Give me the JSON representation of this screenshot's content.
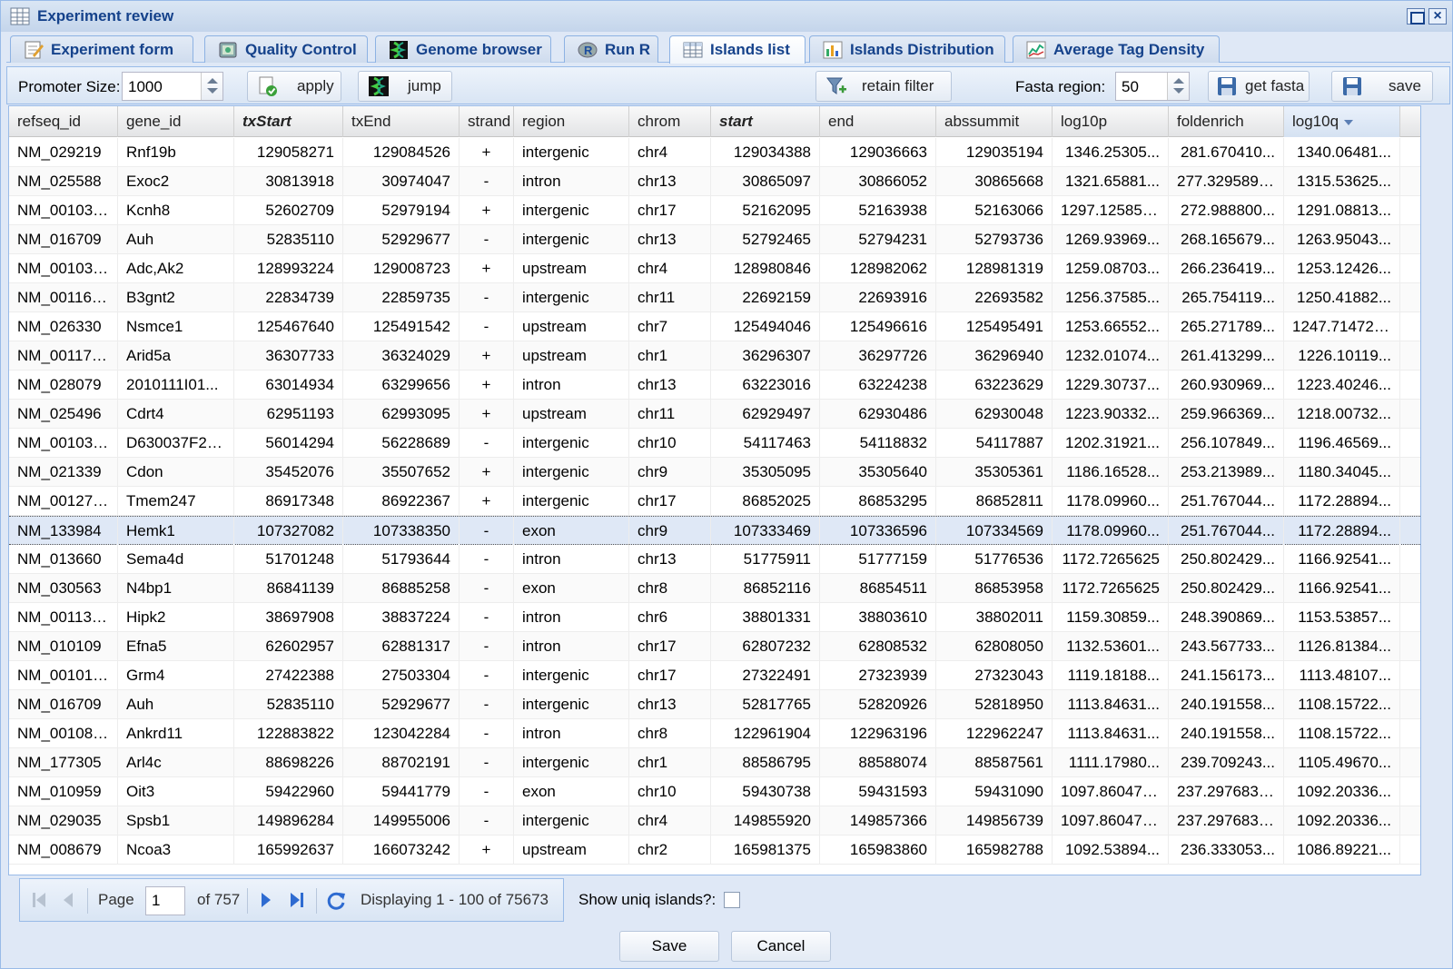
{
  "window": {
    "title": "Experiment review"
  },
  "tabs": [
    {
      "label": "Experiment form",
      "icon": "form-icon"
    },
    {
      "label": "Quality Control",
      "icon": "quality-control-icon"
    },
    {
      "label": "Genome browser",
      "icon": "genome-browser-icon"
    },
    {
      "label": "Run R",
      "icon": "r-logo-icon"
    },
    {
      "label": "Islands list",
      "icon": "table-icon",
      "active": true
    },
    {
      "label": "Islands Distribution",
      "icon": "bar-chart-icon"
    },
    {
      "label": "Average Tag Density",
      "icon": "line-chart-icon"
    }
  ],
  "toolbar": {
    "promoter_label": "Promoter Size:",
    "promoter_value": "1000",
    "apply_label": "apply",
    "jump_label": "jump",
    "retain_filter_label": "retain filter",
    "fasta_label": "Fasta region:",
    "fasta_value": "50",
    "get_fasta_label": "get fasta",
    "save_label": "save"
  },
  "grid": {
    "columns": [
      "refseq_id",
      "gene_id",
      "txStart",
      "txEnd",
      "strand",
      "region",
      "chrom",
      "start",
      "end",
      "abssummit",
      "log10p",
      "foldenrich",
      "log10q"
    ],
    "sorted_column": "log10q",
    "bold_columns": [
      "txStart",
      "start"
    ],
    "selected_row": 13,
    "rows": [
      [
        "NM_029219",
        "Rnf19b",
        "129058271",
        "129084526",
        "+",
        "intergenic",
        "chr4",
        "129034388",
        "129036663",
        "129035194",
        "1346.25305...",
        "281.670410...",
        "1340.06481..."
      ],
      [
        "NM_025588",
        "Exoc2",
        "30813918",
        "30974047",
        "-",
        "intron",
        "chr13",
        "30865097",
        "30866052",
        "30865668",
        "1321.65881...",
        "277.3295898...",
        "1315.53625..."
      ],
      [
        "NM_001031...",
        "Kcnh8",
        "52602709",
        "52979194",
        "+",
        "intergenic",
        "chr17",
        "52162095",
        "52163938",
        "52163066",
        "1297.125854...",
        "272.988800...",
        "1291.08813..."
      ],
      [
        "NM_016709",
        "Auh",
        "52835110",
        "52929677",
        "-",
        "intergenic",
        "chr13",
        "52792465",
        "52794231",
        "52793736",
        "1269.93969...",
        "268.165679...",
        "1263.95043..."
      ],
      [
        "NM_001033...",
        "Adc,Ak2",
        "128993224",
        "129008723",
        "+",
        "upstream",
        "chr4",
        "128980846",
        "128982062",
        "128981319",
        "1259.08703...",
        "266.236419...",
        "1253.12426..."
      ],
      [
        "NM_001169...",
        "B3gnt2",
        "22834739",
        "22859735",
        "-",
        "intergenic",
        "chr11",
        "22692159",
        "22693916",
        "22693582",
        "1256.37585...",
        "265.754119...",
        "1250.41882..."
      ],
      [
        "NM_026330",
        "Nsmce1",
        "125467640",
        "125491542",
        "-",
        "upstream",
        "chr7",
        "125494046",
        "125496616",
        "125495491",
        "1253.66552...",
        "265.271789...",
        "1247.714721..."
      ],
      [
        "NM_001172...",
        "Arid5a",
        "36307733",
        "36324029",
        "+",
        "upstream",
        "chr1",
        "36296307",
        "36297726",
        "36296940",
        "1232.01074...",
        "261.413299...",
        "1226.10119..."
      ],
      [
        "NM_028079",
        "2010111I01...",
        "63014934",
        "63299656",
        "+",
        "intron",
        "chr13",
        "63223016",
        "63224238",
        "63223629",
        "1229.30737...",
        "260.930969...",
        "1223.40246..."
      ],
      [
        "NM_025496",
        "Cdrt4",
        "62951193",
        "62993095",
        "+",
        "upstream",
        "chr11",
        "62929497",
        "62930486",
        "62930048",
        "1223.90332...",
        "259.966369...",
        "1218.00732..."
      ],
      [
        "NM_001033...",
        "D630037F22...",
        "56014294",
        "56228689",
        "-",
        "intergenic",
        "chr10",
        "54117463",
        "54118832",
        "54117887",
        "1202.31921...",
        "256.107849...",
        "1196.46569..."
      ],
      [
        "NM_021339",
        "Cdon",
        "35452076",
        "35507652",
        "+",
        "intergenic",
        "chr9",
        "35305095",
        "35305640",
        "35305361",
        "1186.16528...",
        "253.213989...",
        "1180.34045..."
      ],
      [
        "NM_001277...",
        "Tmem247",
        "86917348",
        "86922367",
        "+",
        "intergenic",
        "chr17",
        "86852025",
        "86853295",
        "86852811",
        "1178.09960...",
        "251.767044...",
        "1172.28894..."
      ],
      [
        "NM_133984",
        "Hemk1",
        "107327082",
        "107338350",
        "-",
        "exon",
        "chr9",
        "107333469",
        "107336596",
        "107334569",
        "1178.09960...",
        "251.767044...",
        "1172.28894..."
      ],
      [
        "NM_013660",
        "Sema4d",
        "51701248",
        "51793644",
        "-",
        "intron",
        "chr13",
        "51775911",
        "51777159",
        "51776536",
        "1172.7265625",
        "250.802429...",
        "1166.92541..."
      ],
      [
        "NM_030563",
        "N4bp1",
        "86841139",
        "86885258",
        "-",
        "exon",
        "chr8",
        "86852116",
        "86854511",
        "86853958",
        "1172.7265625",
        "250.802429...",
        "1166.92541..."
      ],
      [
        "NM_001136...",
        "Hipk2",
        "38697908",
        "38837224",
        "-",
        "intron",
        "chr6",
        "38801331",
        "38803610",
        "38802011",
        "1159.30859...",
        "248.390869...",
        "1153.53857..."
      ],
      [
        "NM_010109",
        "Efna5",
        "62602957",
        "62881317",
        "-",
        "intron",
        "chr17",
        "62807232",
        "62808532",
        "62808050",
        "1132.53601...",
        "243.567733...",
        "1126.81384..."
      ],
      [
        "NM_001013...",
        "Grm4",
        "27422388",
        "27503304",
        "-",
        "intergenic",
        "chr17",
        "27322491",
        "27323939",
        "27323043",
        "1119.18188...",
        "241.156173...",
        "1113.48107..."
      ],
      [
        "NM_016709",
        "Auh",
        "52835110",
        "52929677",
        "-",
        "intergenic",
        "chr13",
        "52817765",
        "52820926",
        "52818950",
        "1113.84631...",
        "240.191558...",
        "1108.15722..."
      ],
      [
        "NM_001081...",
        "Ankrd11",
        "122883822",
        "123042284",
        "-",
        "intron",
        "chr8",
        "122961904",
        "122963196",
        "122962247",
        "1113.84631...",
        "240.191558...",
        "1108.15722..."
      ],
      [
        "NM_177305",
        "Arl4c",
        "88698226",
        "88702191",
        "-",
        "intergenic",
        "chr1",
        "88586795",
        "88588074",
        "88587561",
        "1111.17980...",
        "239.709243...",
        "1105.49670..."
      ],
      [
        "NM_010959",
        "Oit3",
        "59422960",
        "59441779",
        "-",
        "exon",
        "chr10",
        "59430738",
        "59431593",
        "59431090",
        "1097.860473...",
        "237.2976837...",
        "1092.20336..."
      ],
      [
        "NM_029035",
        "Spsb1",
        "149896284",
        "149955006",
        "-",
        "intergenic",
        "chr4",
        "149855920",
        "149857366",
        "149856739",
        "1097.860473...",
        "237.2976837...",
        "1092.20336..."
      ],
      [
        "NM_008679",
        "Ncoa3",
        "165992637",
        "166073242",
        "+",
        "upstream",
        "chr2",
        "165981375",
        "165983860",
        "165982788",
        "1092.53894...",
        "236.333053...",
        "1086.89221..."
      ]
    ]
  },
  "pager": {
    "page_label": "Page",
    "page_value": "1",
    "of_label": "of 757",
    "display_text": "Displaying 1 - 100 of 75673"
  },
  "uniq_label": "Show uniq islands?:",
  "footer": {
    "save_label": "Save",
    "cancel_label": "Cancel"
  }
}
